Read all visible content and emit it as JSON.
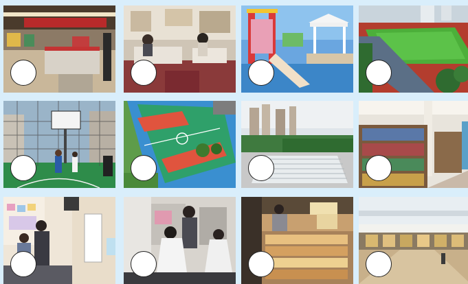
{
  "tiles": [
    {
      "icon": "supermarket-checkout-photo"
    },
    {
      "icon": "restaurant-dining-photo"
    },
    {
      "icon": "children-playground-photo"
    },
    {
      "icon": "sports-stadium-track-photo"
    },
    {
      "icon": "basketball-court-photo"
    },
    {
      "icon": "tennis-court-aerial-photo"
    },
    {
      "icon": "swimming-pool-photo"
    },
    {
      "icon": "library-bookshelves-photo"
    },
    {
      "icon": "clinic-waiting-room-photo"
    },
    {
      "icon": "hair-salon-photo"
    },
    {
      "icon": "bakery-display-photo"
    },
    {
      "icon": "shopping-mall-photo"
    }
  ],
  "colors": {
    "background": "#d9eefb",
    "circle_fill": "#ffffff",
    "circle_stroke": "#222222"
  }
}
